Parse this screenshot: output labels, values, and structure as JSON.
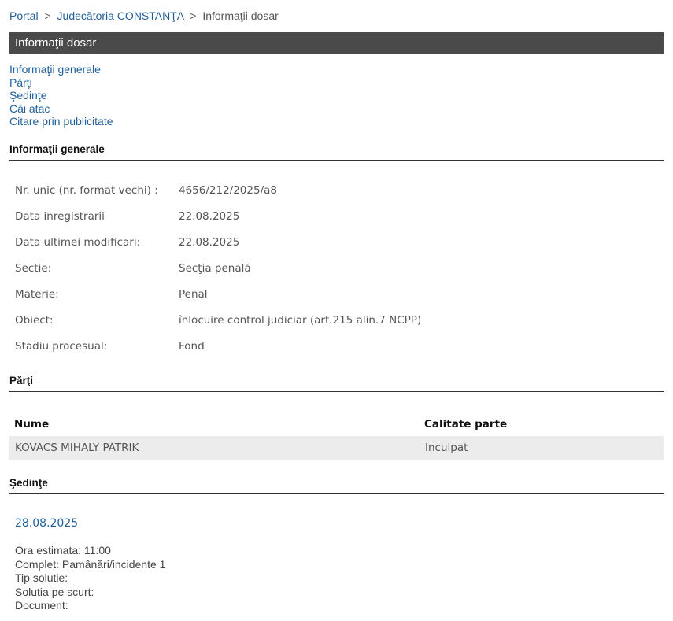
{
  "breadcrumb": {
    "portal": "Portal",
    "separator": ">",
    "court": "Judecătoria CONSTANŢA",
    "current": "Informaţii dosar"
  },
  "panel": {
    "title": "Informaţii dosar"
  },
  "toc": {
    "items": [
      "Informaţii generale",
      "Părţi",
      "Şedinţe",
      "Căi atac",
      "Citare prin publicitate"
    ]
  },
  "general": {
    "heading": "Informaţii generale",
    "rows": [
      {
        "label": "Nr. unic (nr. format vechi) :",
        "value": "4656/212/2025/a8"
      },
      {
        "label": "Data inregistrarii",
        "value": "22.08.2025"
      },
      {
        "label": "Data ultimei modificari:",
        "value": "22.08.2025"
      },
      {
        "label": "Sectie:",
        "value": "Secţia penală"
      },
      {
        "label": "Materie:",
        "value": "Penal"
      },
      {
        "label": "Obiect:",
        "value": "înlocuire control judiciar (art.215 alin.7 NCPP)"
      },
      {
        "label": "Stadiu procesual:",
        "value": "Fond"
      }
    ]
  },
  "parti": {
    "heading": "Părţi",
    "columns": {
      "name": "Nume",
      "role": "Calitate parte"
    },
    "rows": [
      {
        "name": "KOVACS MIHALY PATRIK",
        "role": "Inculpat"
      }
    ]
  },
  "sedinte": {
    "heading": "Şedinţe",
    "date": "28.08.2025",
    "details": [
      "Ora estimata: 11:00",
      "Complet: Pamânări/incidente 1",
      "Tip solutie:",
      "Solutia pe scurt:",
      "Document:"
    ]
  }
}
